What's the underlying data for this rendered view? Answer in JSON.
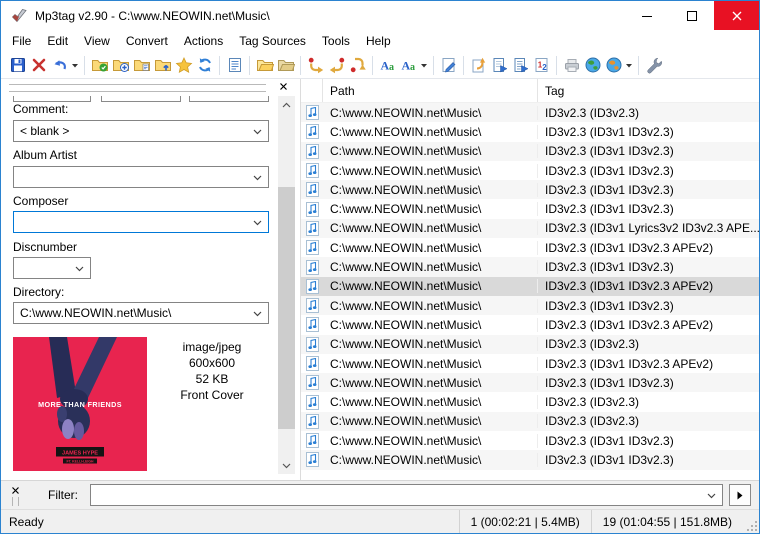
{
  "window": {
    "title": "Mp3tag v2.90 -  C:\\www.NEOWIN.net\\Music\\",
    "controls": [
      "minimize",
      "maximize",
      "close"
    ]
  },
  "menu": {
    "items": [
      "File",
      "Edit",
      "View",
      "Convert",
      "Actions",
      "Tag Sources",
      "Tools",
      "Help"
    ]
  },
  "toolbar": {
    "icons": [
      "save",
      "remove-tag",
      "undo",
      "undo-dropdown",
      "change-directory",
      "add-directory",
      "playlist-directory",
      "parent-directory",
      "favorite-directories",
      "refresh",
      "tag-panel-toggle",
      "library-folder",
      "library-remove-folder",
      "convert-tag-filename",
      "convert-filename-tag",
      "convert-tag-tag",
      "case-conversion",
      "case-conversion-menu",
      "case-conversion-dropdown",
      "actions",
      "export",
      "playlist-file",
      "text-file",
      "auto-numbering-wizard",
      "print",
      "web-source-discogs",
      "web-source-musicbrainz",
      "web-source-dropdown",
      "options"
    ]
  },
  "tag_panel": {
    "fields": {
      "comment": {
        "label": "Comment:",
        "value": "< blank >"
      },
      "album_artist": {
        "label": "Album Artist",
        "value": ""
      },
      "composer": {
        "label": "Composer",
        "value": ""
      },
      "discnumber": {
        "label": "Discnumber",
        "value": ""
      },
      "directory": {
        "label": "Directory:",
        "value": "C:\\www.NEOWIN.net\\Music\\"
      }
    },
    "artwork": {
      "title_text": "MORE THAN FRIENDS",
      "artist_text": "JAMES HYPE",
      "feat_text": "FT. KELLI-LEIGH",
      "bg_color": "#e8244f",
      "info": [
        "image/jpeg",
        "600x600",
        "52 KB",
        "Front Cover"
      ]
    }
  },
  "file_list": {
    "columns": [
      "Path",
      "Tag"
    ],
    "selected_index": 9,
    "rows": [
      {
        "path": "C:\\www.NEOWIN.net\\Music\\",
        "tag": "ID3v2.3 (ID3v2.3)"
      },
      {
        "path": "C:\\www.NEOWIN.net\\Music\\",
        "tag": "ID3v2.3 (ID3v1 ID3v2.3)"
      },
      {
        "path": "C:\\www.NEOWIN.net\\Music\\",
        "tag": "ID3v2.3 (ID3v1 ID3v2.3)"
      },
      {
        "path": "C:\\www.NEOWIN.net\\Music\\",
        "tag": "ID3v2.3 (ID3v1 ID3v2.3)"
      },
      {
        "path": "C:\\www.NEOWIN.net\\Music\\",
        "tag": "ID3v2.3 (ID3v1 ID3v2.3)"
      },
      {
        "path": "C:\\www.NEOWIN.net\\Music\\",
        "tag": "ID3v2.3 (ID3v1 ID3v2.3)"
      },
      {
        "path": "C:\\www.NEOWIN.net\\Music\\",
        "tag": "ID3v2.3 (ID3v1 Lyrics3v2 ID3v2.3 APE..."
      },
      {
        "path": "C:\\www.NEOWIN.net\\Music\\",
        "tag": "ID3v2.3 (ID3v1 ID3v2.3 APEv2)"
      },
      {
        "path": "C:\\www.NEOWIN.net\\Music\\",
        "tag": "ID3v2.3 (ID3v1 ID3v2.3)"
      },
      {
        "path": "C:\\www.NEOWIN.net\\Music\\",
        "tag": "ID3v2.3 (ID3v1 ID3v2.3 APEv2)"
      },
      {
        "path": "C:\\www.NEOWIN.net\\Music\\",
        "tag": "ID3v2.3 (ID3v1 ID3v2.3)"
      },
      {
        "path": "C:\\www.NEOWIN.net\\Music\\",
        "tag": "ID3v2.3 (ID3v1 ID3v2.3 APEv2)"
      },
      {
        "path": "C:\\www.NEOWIN.net\\Music\\",
        "tag": "ID3v2.3 (ID3v2.3)"
      },
      {
        "path": "C:\\www.NEOWIN.net\\Music\\",
        "tag": "ID3v2.3 (ID3v1 ID3v2.3 APEv2)"
      },
      {
        "path": "C:\\www.NEOWIN.net\\Music\\",
        "tag": "ID3v2.3 (ID3v1 ID3v2.3)"
      },
      {
        "path": "C:\\www.NEOWIN.net\\Music\\",
        "tag": "ID3v2.3 (ID3v2.3)"
      },
      {
        "path": "C:\\www.NEOWIN.net\\Music\\",
        "tag": "ID3v2.3 (ID3v2.3)"
      },
      {
        "path": "C:\\www.NEOWIN.net\\Music\\",
        "tag": "ID3v2.3 (ID3v1 ID3v2.3)"
      },
      {
        "path": "C:\\www.NEOWIN.net\\Music\\",
        "tag": "ID3v2.3 (ID3v1 ID3v2.3)"
      }
    ]
  },
  "filter": {
    "label": "Filter:",
    "value": ""
  },
  "status": {
    "left": "Ready",
    "cells": [
      "1 (00:02:21 | 5.4MB)",
      "19 (01:04:55 | 151.8MB)"
    ]
  },
  "colors": {
    "accent": "#0078d7",
    "close_button": "#e81123",
    "selected_row": "#d9d9d9",
    "row_stripe": "#f6f6f6",
    "artwork_pink": "#e8244f"
  }
}
